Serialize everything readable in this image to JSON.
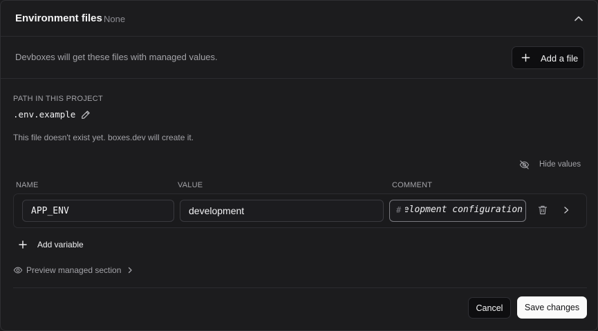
{
  "section": {
    "title": "Environment files",
    "badge": "None",
    "collapse_icon": "chevron-up-icon"
  },
  "description": {
    "text": "Devboxes will get these files with managed values.",
    "add_file_label": "Add a file"
  },
  "file": {
    "path_label": "PATH IN THIS PROJECT",
    "path_value": ".env.example",
    "notice": "This file doesn't exist yet. boxes.dev will create it.",
    "hide_values_label": "Hide values"
  },
  "table": {
    "columns": [
      "NAME",
      "VALUE",
      "COMMENT"
    ],
    "rows": [
      {
        "name": "APP_ENV",
        "value": "development",
        "comment_prefix": "#",
        "comment": "Development configuration"
      }
    ]
  },
  "actions": {
    "add_variable_label": "Add variable",
    "preview_label": "Preview managed section",
    "cancel_label": "Cancel",
    "save_label": "Save changes"
  },
  "colors": {
    "background": "#1c1c1e",
    "border": "#2c2c30",
    "muted_text": "#a3a3a8",
    "primary_button": "#fafafa"
  }
}
